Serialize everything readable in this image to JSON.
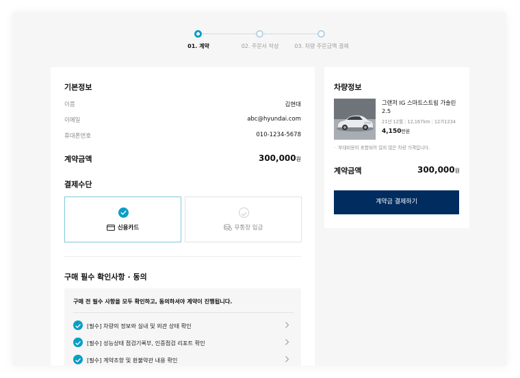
{
  "steps": [
    {
      "label": "01. 계약",
      "active": true
    },
    {
      "label": "02. 주문서 작성",
      "active": false
    },
    {
      "label": "03. 차량 주문금액 결제",
      "active": false
    }
  ],
  "basic_info": {
    "title": "기본정보",
    "rows": [
      {
        "label": "이름",
        "value": "김현대"
      },
      {
        "label": "이메일",
        "value": "abc@hyundai.com"
      },
      {
        "label": "휴대폰번호",
        "value": "010-1234-5678"
      }
    ]
  },
  "contract_amount": {
    "label": "계약금액",
    "value": "300,000",
    "unit": "원"
  },
  "payment_method": {
    "title": "결제수단",
    "options": [
      {
        "label": "신용카드",
        "icon": "credit-card-icon",
        "selected": true
      },
      {
        "label": "무통장 입금",
        "icon": "coins-icon",
        "selected": false
      }
    ]
  },
  "agreement": {
    "title": "구매 필수 확인사항 · 동의",
    "header": "구매 전 필수 사항을 모두 확인하고, 동의하셔야 계약이 진행됩니다.",
    "items": [
      {
        "label": "[필수] 차량의 정보와 실내 및 외관 상태 확인"
      },
      {
        "label": "[필수] 성능상태 점검기록부, 인증점검 리포트 확인"
      },
      {
        "label": "[필수] 계약조항 및 환불약관 내용 확인"
      }
    ]
  },
  "vehicle": {
    "title": "차량정보",
    "name": "그랜저 IG 스마트스트림 가솔린 2.5",
    "meta": [
      "21년 12월",
      "12,167km",
      "12가1234"
    ],
    "price": "4,150",
    "price_unit": "만원",
    "note": "부대비용이 포함되어 있지 않은 차량 가격입니다.",
    "amount_label": "계약금액",
    "amount_value": "300,000",
    "amount_unit": "원",
    "button_label": "계약금 결제하기"
  },
  "colors": {
    "accent": "#0a9ec6",
    "navy": "#002c5f",
    "background": "#f6f6f6"
  }
}
